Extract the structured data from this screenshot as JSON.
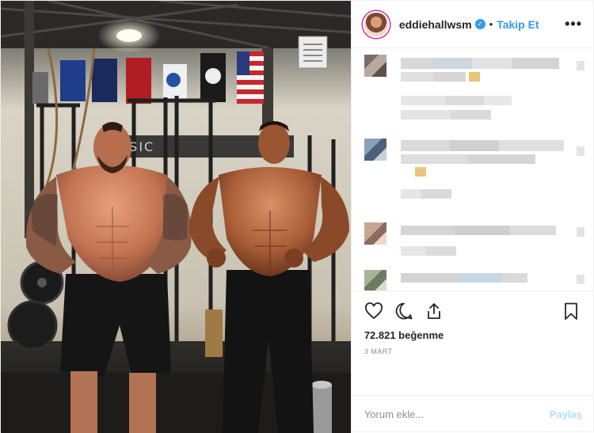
{
  "post": {
    "username": "eddiehallwsm",
    "separator": "•",
    "follow_label": "Takip Et",
    "more_label": "•••",
    "likes": "72.821 beğenme",
    "date": "3 MART",
    "comment_placeholder": "Yorum ekle...",
    "share_label": "Paylaş"
  },
  "icons": {
    "verified": "verified-badge-icon",
    "like": "heart-icon",
    "comment": "comment-bubble-icon",
    "share": "share-upload-icon",
    "save": "bookmark-icon"
  },
  "colors": {
    "accent": "#3897f0",
    "share_disabled": "#b2dffc",
    "muted": "#8e8e8e",
    "border": "#efefef"
  }
}
